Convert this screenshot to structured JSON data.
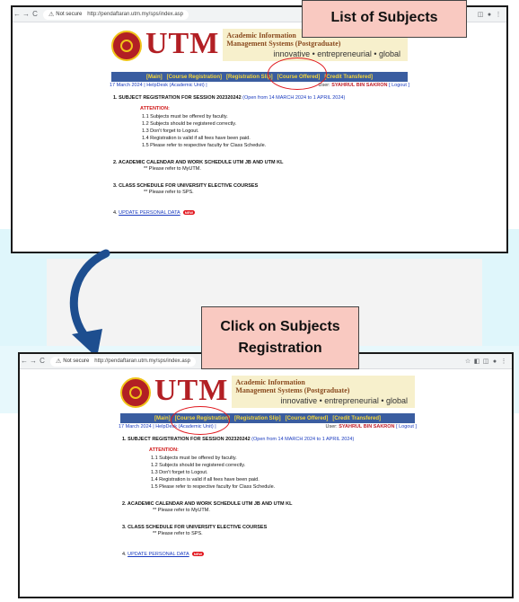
{
  "browser": {
    "not_secure": "Not secure",
    "url": "http://pendaftaran.utm.my/sps/index.asp",
    "back": "←",
    "forward": "→",
    "reload": "C"
  },
  "utm": {
    "logo_text": "UTM",
    "university_name": "UNIVERSITI TEKNOLOGI MALAYSIA",
    "system_title_top": "Academic Information",
    "system_title_sub": "Management Systems (Postgraduate)",
    "tagline": "innovative • entrepreneurial • global"
  },
  "menu": [
    "[Main]",
    "[Course Registration]",
    "[Registration Slip]",
    "[Course Offered]",
    "[Credit Transfered]"
  ],
  "info": {
    "date": "17 March 2024",
    "links": "| HelpDesk (Academic Unit) |",
    "user_label": "User:",
    "user_name": "SYAHRUL BIN SAKRON",
    "logout": "[ Logout ]"
  },
  "content": {
    "sec1_title": "1. SUBJECT REGISTRATION FOR SESSION  202320242",
    "sec1_period": "(Open from 14 MARCH 2024 to 1 APRIL 2024)",
    "attention": "ATTENTION:",
    "items": [
      "1.1  Subjects must be offered by faculty.",
      "1.2  Subjects should be registered correctly.",
      "1.3  Don't forget to Logout.",
      "1.4  Registration is valid if all fees have been paid.",
      "1.5  Please refer to respective faculty for Class Schedule."
    ],
    "sec2_title": "2. ACADEMIC CALENDAR AND WORK SCHEDULE UTM JB AND UTM KL",
    "sec2_note": "**   Please refer to MyUTM.",
    "sec3_title": "3. CLASS SCHEDULE FOR UNIVERSITY ELECTIVE COURSES",
    "sec3_note": "**   Please refer to SPS.",
    "sec4_prefix": "4. ",
    "sec4_link": "UPDATE PERSONAL DATA",
    "new_badge": "NEW"
  },
  "callouts": {
    "top": "List of Subjects",
    "bottom_line1": "Click on Subjects",
    "bottom_line2": "Registration"
  },
  "colors": {
    "accent_arrow": "#1d4e8f",
    "callout_fill": "#f9c9c1",
    "highlight_ring": "#e0191f",
    "menu_bar": "#3a5da0",
    "menu_text": "#f5d63a"
  }
}
